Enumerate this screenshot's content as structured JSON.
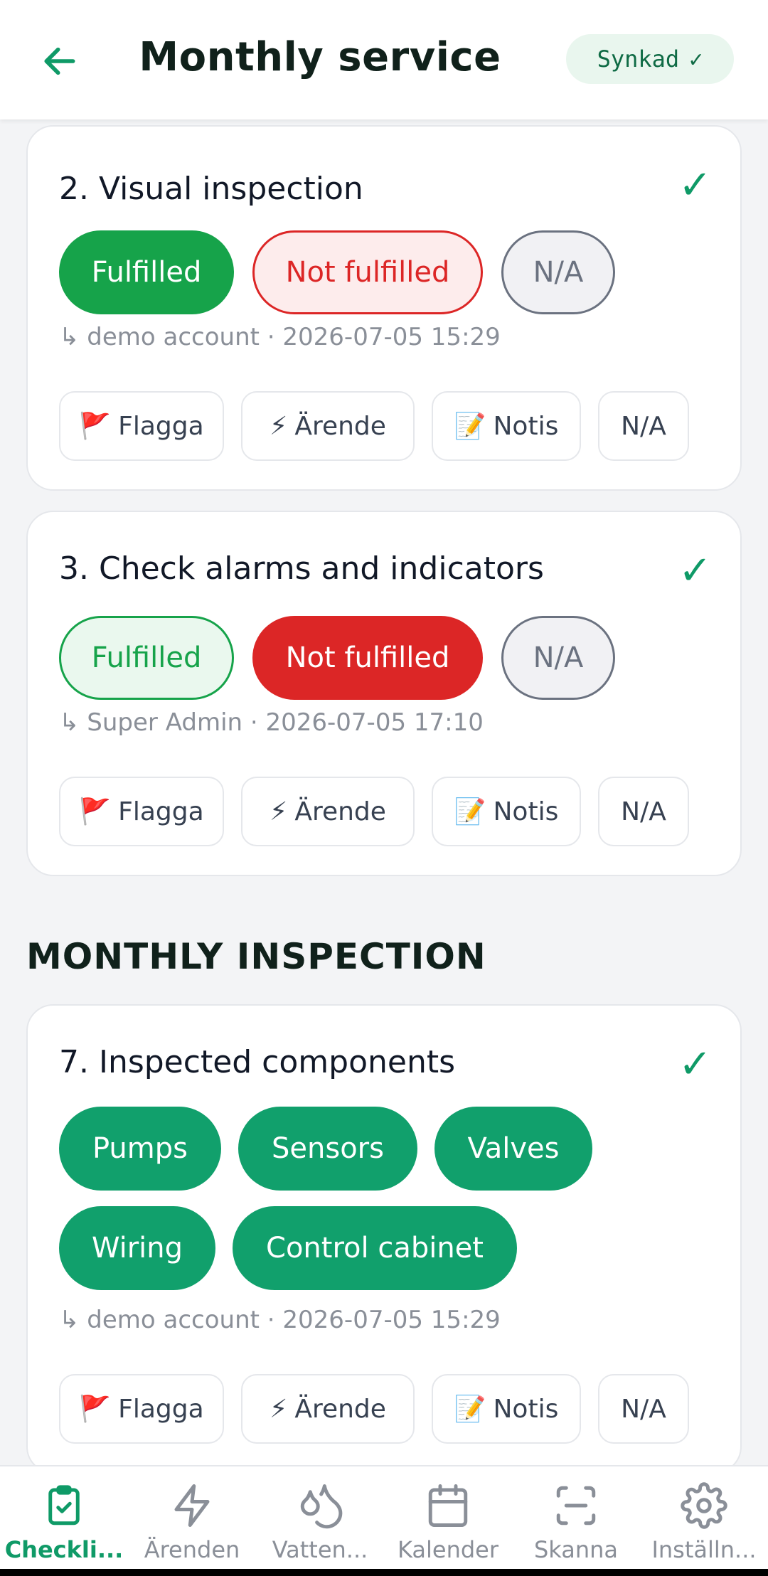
{
  "header": {
    "title": "Monthly service",
    "sync_label": "Synkad",
    "sync_icon": "✓"
  },
  "cards": [
    {
      "title": "2. Visual inspection",
      "check": "✓",
      "options": [
        "Fulfilled",
        "Not fulfilled",
        "N/A"
      ],
      "selected": "Fulfilled",
      "meta": "↳ demo account · 2026-07-05 15:29",
      "actions": {
        "flag": "Flagga",
        "issue": "Ärende",
        "note": "Notis",
        "na": "N/A"
      }
    },
    {
      "title": "3. Check alarms and indicators",
      "check": "✓",
      "options": [
        "Fulfilled",
        "Not fulfilled",
        "N/A"
      ],
      "selected": "Not fulfilled",
      "meta": "↳ Super Admin · 2026-07-05 17:10",
      "actions": {
        "flag": "Flagga",
        "issue": "Ärende",
        "note": "Notis",
        "na": "N/A"
      }
    }
  ],
  "section": {
    "heading": "MONTHLY INSPECTION"
  },
  "components_card": {
    "title": "7. Inspected components",
    "check": "✓",
    "chips": [
      "Pumps",
      "Sensors",
      "Valves",
      "Wiring",
      "Control cabinet"
    ],
    "meta": "↳ demo account · 2026-07-05 15:29",
    "actions": {
      "flag": "Flagga",
      "issue": "Ärende",
      "note": "Notis",
      "na": "N/A"
    }
  },
  "action_icons": {
    "flag": "🚩",
    "issue": "⚡",
    "note": "📝"
  },
  "nav": {
    "items": [
      {
        "label": "Checkli...",
        "icon": "clipboard-check-icon",
        "active": true
      },
      {
        "label": "Ärenden",
        "icon": "lightning-icon",
        "active": false
      },
      {
        "label": "Vatten...",
        "icon": "water-drops-icon",
        "active": false
      },
      {
        "label": "Kalender",
        "icon": "calendar-icon",
        "active": false
      },
      {
        "label": "Skanna",
        "icon": "scan-icon",
        "active": false
      },
      {
        "label": "Inställn...",
        "icon": "gear-icon",
        "active": false
      }
    ]
  },
  "colors": {
    "accent": "#0f9a67",
    "fulfilled": "#16a34a",
    "not_fulfilled": "#dc2626",
    "chip": "#11a06c"
  }
}
